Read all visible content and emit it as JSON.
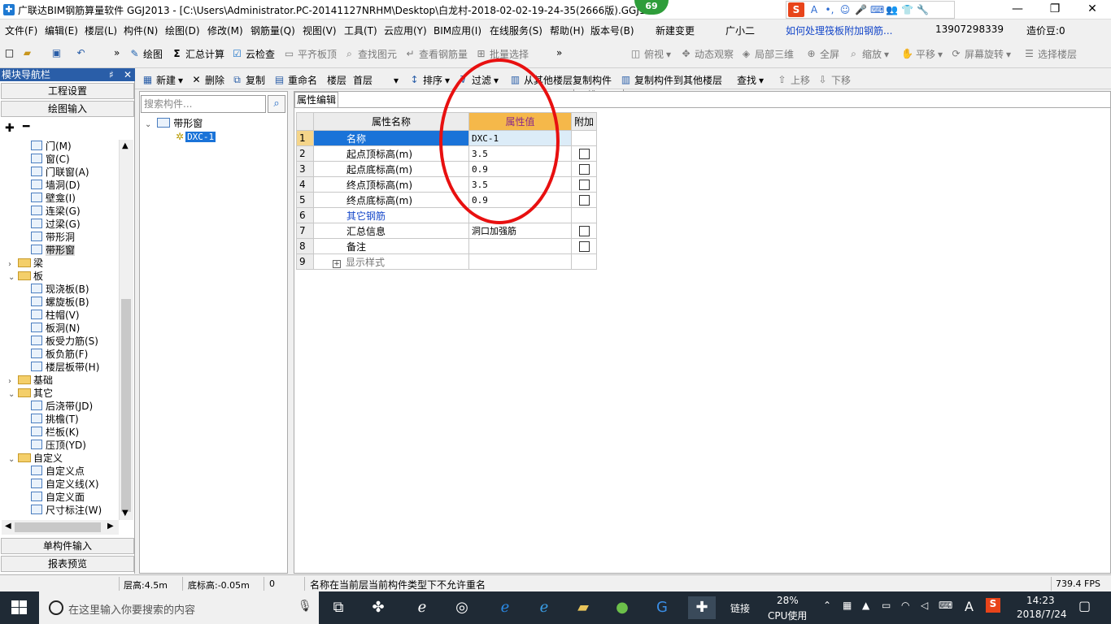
{
  "window": {
    "title": "广联达BIM钢筋算量软件 GGJ2013 - [C:\\Users\\Administrator.PC-20141127NRHM\\Desktop\\白龙村-2018-02-02-19-24-35(2666版).GGJ12",
    "badge": "69",
    "min": "—",
    "max": "❐",
    "close": "✕"
  },
  "ime": {
    "logo": "S",
    "icons": [
      "A",
      "•,",
      "☺",
      "🎤",
      "⌨",
      "👥",
      "👕",
      "🔧"
    ]
  },
  "menu": [
    "文件(F)",
    "编辑(E)",
    "楼层(L)",
    "构件(N)",
    "绘图(D)",
    "修改(M)",
    "钢筋量(Q)",
    "视图(V)",
    "工具(T)",
    "云应用(Y)",
    "BIM应用(I)",
    "在线服务(S)",
    "帮助(H)",
    "版本号(B)",
    "新建变更",
    "广小二",
    "如何处理筏板附加钢筋...",
    "13907298339",
    "造价豆:0"
  ],
  "toolbar1": {
    "draw": "绘图",
    "sum": "汇总计算",
    "cloudcheck": "云检查",
    "flatboard": "平齐板顶",
    "findelem": "查找图元",
    "viewrebar": "查看钢筋量",
    "batchselect": "批量选择",
    "view2d": "二维",
    "topview": "俯视",
    "dynamic": "动态观察",
    "local3d": "局部三维",
    "fullscreen": "全屏",
    "zoom": "缩放",
    "pan": "平移",
    "rotate": "屏幕旋转",
    "selectfloor": "选择楼层"
  },
  "toolbar2": {
    "new": "新建",
    "delete": "删除",
    "copy": "复制",
    "rename": "重命名",
    "floor_label": "楼层",
    "floor_value": "首层",
    "sort": "排序",
    "filter": "过滤",
    "copyfrom": "从其他楼层复制构件",
    "copyto": "复制构件到其他楼层",
    "find": "查找",
    "up": "上移",
    "down": "下移"
  },
  "nav": {
    "header": "模块导航栏",
    "pin": "♯",
    "close": "✕",
    "project_settings": "工程设置",
    "drawing_input": "绘图输入",
    "single_input": "单构件输入",
    "report_preview": "报表预览",
    "items": [
      {
        "label": "门(M)",
        "level": 2,
        "type": "leaf"
      },
      {
        "label": "窗(C)",
        "level": 2,
        "type": "leaf"
      },
      {
        "label": "门联窗(A)",
        "level": 2,
        "type": "leaf"
      },
      {
        "label": "墙洞(D)",
        "level": 2,
        "type": "leaf"
      },
      {
        "label": "壁龛(I)",
        "level": 2,
        "type": "leaf"
      },
      {
        "label": "连梁(G)",
        "level": 2,
        "type": "leaf"
      },
      {
        "label": "过梁(G)",
        "level": 2,
        "type": "leaf"
      },
      {
        "label": "带形洞",
        "level": 2,
        "type": "leaf"
      },
      {
        "label": "带形窗",
        "level": 2,
        "type": "leaf",
        "selected": true
      },
      {
        "label": "梁",
        "level": 1,
        "type": "folder",
        "exp": "›"
      },
      {
        "label": "板",
        "level": 1,
        "type": "folder",
        "exp": "⌄"
      },
      {
        "label": "现浇板(B)",
        "level": 2,
        "type": "leaf"
      },
      {
        "label": "螺旋板(B)",
        "level": 2,
        "type": "leaf"
      },
      {
        "label": "柱帽(V)",
        "level": 2,
        "type": "leaf"
      },
      {
        "label": "板洞(N)",
        "level": 2,
        "type": "leaf"
      },
      {
        "label": "板受力筋(S)",
        "level": 2,
        "type": "leaf"
      },
      {
        "label": "板负筋(F)",
        "level": 2,
        "type": "leaf"
      },
      {
        "label": "楼层板带(H)",
        "level": 2,
        "type": "leaf"
      },
      {
        "label": "基础",
        "level": 1,
        "type": "folder",
        "exp": "›"
      },
      {
        "label": "其它",
        "level": 1,
        "type": "folder",
        "exp": "⌄"
      },
      {
        "label": "后浇带(JD)",
        "level": 2,
        "type": "leaf"
      },
      {
        "label": "挑檐(T)",
        "level": 2,
        "type": "leaf"
      },
      {
        "label": "栏板(K)",
        "level": 2,
        "type": "leaf"
      },
      {
        "label": "压顶(YD)",
        "level": 2,
        "type": "leaf"
      },
      {
        "label": "自定义",
        "level": 1,
        "type": "folder",
        "exp": "⌄"
      },
      {
        "label": "自定义点",
        "level": 2,
        "type": "leaf"
      },
      {
        "label": "自定义线(X)",
        "level": 2,
        "type": "leaf"
      },
      {
        "label": "自定义面",
        "level": 2,
        "type": "leaf"
      },
      {
        "label": "尺寸标注(W)",
        "level": 2,
        "type": "leaf"
      }
    ]
  },
  "components": {
    "search_placeholder": "搜索构件...",
    "root": "带形窗",
    "child": "DXC-1"
  },
  "props": {
    "tab": "属性编辑",
    "col_name": "属性名称",
    "col_value": "属性值",
    "col_extra": "附加",
    "rows": [
      {
        "n": "1",
        "name": "名称",
        "value": "DXC-1",
        "check": false,
        "style": "sel"
      },
      {
        "n": "2",
        "name": "起点顶标高(m)",
        "value": "3.5",
        "check": true
      },
      {
        "n": "3",
        "name": "起点底标高(m)",
        "value": "0.9",
        "check": true
      },
      {
        "n": "4",
        "name": "终点顶标高(m)",
        "value": "3.5",
        "check": true
      },
      {
        "n": "5",
        "name": "终点底标高(m)",
        "value": "0.9",
        "check": true
      },
      {
        "n": "6",
        "name": "其它钢筋",
        "value": "",
        "check": false,
        "style": "blue"
      },
      {
        "n": "7",
        "name": "汇总信息",
        "value": "洞口加强筋",
        "check": true
      },
      {
        "n": "8",
        "name": "备注",
        "value": "",
        "check": true
      },
      {
        "n": "9",
        "name": "显示样式",
        "value": "",
        "check": false,
        "style": "gray",
        "plus": "+"
      }
    ]
  },
  "status": {
    "floor_height": "层高:4.5m",
    "base_elev": "底标高:-0.05m",
    "zero": "0",
    "message": "名称在当前层当前构件类型下不允许重名",
    "fps": "739.4 FPS"
  },
  "taskbar": {
    "search_placeholder": "在这里输入你要搜索的内容",
    "link": "链接",
    "cpu_pct": "28%",
    "cpu_label": "CPU使用",
    "time": "14:23",
    "date": "2018/7/24",
    "lang": "A"
  },
  "colors": {
    "highlight_circle": "#e81010",
    "selected_row": "#1a73d8",
    "value_header": "#f5b84a"
  }
}
